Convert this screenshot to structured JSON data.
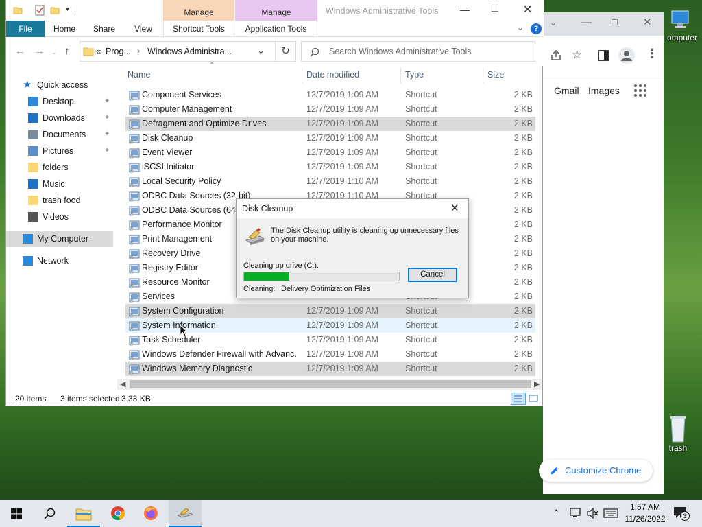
{
  "desktop": {
    "icons": [
      {
        "label": "omputer",
        "icon": "computer-icon"
      },
      {
        "label": "trash",
        "icon": "recycle-bin-icon"
      }
    ]
  },
  "chrome": {
    "links": [
      "Gmail",
      "Images"
    ],
    "customize_label": "Customize Chrome"
  },
  "explorer": {
    "window_title": "Windows Administrative Tools",
    "context_tabs": [
      "Manage",
      "Manage"
    ],
    "tabs": [
      "File",
      "Home",
      "Share",
      "View",
      "Shortcut Tools",
      "Application Tools"
    ],
    "address": {
      "prefix": "«",
      "crumbs": [
        "Prog...",
        "Windows Administra..."
      ]
    },
    "search_placeholder": "Search Windows Administrative Tools",
    "nav_pane": [
      {
        "label": "Quick access",
        "icon": "star-icon",
        "pinned": false,
        "indent": 0
      },
      {
        "label": "Desktop",
        "icon": "desktop-folder-icon",
        "pinned": true,
        "indent": 1
      },
      {
        "label": "Downloads",
        "icon": "downloads-icon",
        "pinned": true,
        "indent": 1
      },
      {
        "label": "Documents",
        "icon": "documents-icon",
        "pinned": true,
        "indent": 1
      },
      {
        "label": "Pictures",
        "icon": "pictures-icon",
        "pinned": true,
        "indent": 1
      },
      {
        "label": "folders",
        "icon": "folder-icon",
        "pinned": false,
        "indent": 1
      },
      {
        "label": "Music",
        "icon": "music-icon",
        "pinned": false,
        "indent": 1
      },
      {
        "label": "trash food",
        "icon": "folder-icon",
        "pinned": false,
        "indent": 1
      },
      {
        "label": "Videos",
        "icon": "videos-icon",
        "pinned": false,
        "indent": 1
      },
      {
        "label": "My Computer",
        "icon": "computer-icon",
        "pinned": false,
        "indent": 0
      },
      {
        "label": "Network",
        "icon": "network-icon",
        "pinned": false,
        "indent": 0
      }
    ],
    "columns": [
      "Name",
      "Date modified",
      "Type",
      "Size"
    ],
    "files": [
      {
        "name": "Component Services",
        "date": "12/7/2019 1:09 AM",
        "type": "Shortcut",
        "size": "2 KB",
        "state": ""
      },
      {
        "name": "Computer Management",
        "date": "12/7/2019 1:09 AM",
        "type": "Shortcut",
        "size": "2 KB",
        "state": ""
      },
      {
        "name": "Defragment and Optimize Drives",
        "date": "12/7/2019 1:09 AM",
        "type": "Shortcut",
        "size": "2 KB",
        "state": "sel"
      },
      {
        "name": "Disk Cleanup",
        "date": "12/7/2019 1:09 AM",
        "type": "Shortcut",
        "size": "2 KB",
        "state": ""
      },
      {
        "name": "Event Viewer",
        "date": "12/7/2019 1:09 AM",
        "type": "Shortcut",
        "size": "2 KB",
        "state": ""
      },
      {
        "name": "iSCSI Initiator",
        "date": "12/7/2019 1:09 AM",
        "type": "Shortcut",
        "size": "2 KB",
        "state": ""
      },
      {
        "name": "Local Security Policy",
        "date": "12/7/2019 1:10 AM",
        "type": "Shortcut",
        "size": "2 KB",
        "state": ""
      },
      {
        "name": "ODBC Data Sources (32-bit)",
        "date": "12/7/2019 1:10 AM",
        "type": "Shortcut",
        "size": "2 KB",
        "state": ""
      },
      {
        "name": "ODBC Data Sources (64-bi",
        "date": "",
        "type": "",
        "size": "2 KB",
        "state": ""
      },
      {
        "name": "Performance Monitor",
        "date": "",
        "type": "",
        "size": "2 KB",
        "state": ""
      },
      {
        "name": "Print Management",
        "date": "",
        "type": "",
        "size": "2 KB",
        "state": ""
      },
      {
        "name": "Recovery Drive",
        "date": "",
        "type": "",
        "size": "2 KB",
        "state": ""
      },
      {
        "name": "Registry Editor",
        "date": "",
        "type": "",
        "size": "2 KB",
        "state": ""
      },
      {
        "name": "Resource Monitor",
        "date": "",
        "type": "",
        "size": "2 KB",
        "state": ""
      },
      {
        "name": "Services",
        "date": "",
        "type": "Shortcut",
        "size": "2 KB",
        "state": ""
      },
      {
        "name": "System Configuration",
        "date": "12/7/2019 1:09 AM",
        "type": "Shortcut",
        "size": "2 KB",
        "state": "sel"
      },
      {
        "name": "System Information",
        "date": "12/7/2019 1:09 AM",
        "type": "Shortcut",
        "size": "2 KB",
        "state": "hov"
      },
      {
        "name": "Task Scheduler",
        "date": "12/7/2019 1:09 AM",
        "type": "Shortcut",
        "size": "2 KB",
        "state": ""
      },
      {
        "name": "Windows Defender Firewall with Advanc...",
        "date": "12/7/2019 1:08 AM",
        "type": "Shortcut",
        "size": "2 KB",
        "state": ""
      },
      {
        "name": "Windows Memory Diagnostic",
        "date": "12/7/2019 1:09 AM",
        "type": "Shortcut",
        "size": "2 KB",
        "state": "sel"
      }
    ],
    "status": {
      "items": "20 items",
      "selected": "3 items selected",
      "size": "3.33 KB"
    }
  },
  "dialog": {
    "title": "Disk Cleanup",
    "message": "The Disk Cleanup utility is cleaning up unnecessary files on your machine.",
    "drive_label": "Cleaning up drive  (C:).",
    "progress_fraction": 0.29,
    "cleaning_label": "Cleaning:",
    "cleaning_item": "Delivery Optimization Files",
    "cancel_label": "Cancel"
  },
  "taskbar": {
    "time": "1:57 AM",
    "date": "11/26/2022",
    "notification_count": "3",
    "apps": [
      "start-icon",
      "search-icon",
      "file-explorer-icon",
      "chrome-icon",
      "firefox-icon",
      "disk-cleanup-icon"
    ]
  },
  "colors": {
    "accent": "#0078d7",
    "file_tab": "#1a7a9a",
    "manage1": "#f9d6b8",
    "manage2": "#e8c8f0",
    "progress": "#06b025",
    "selection": "#d9d9d9"
  }
}
